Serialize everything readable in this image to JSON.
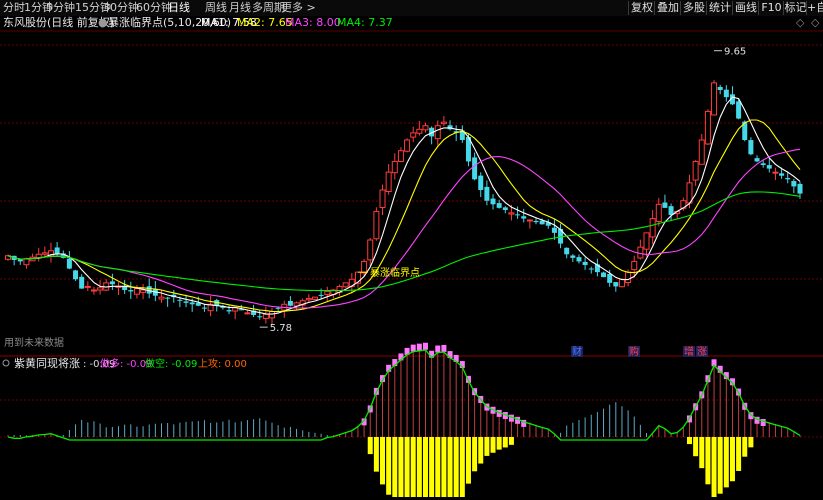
{
  "toolbar": {
    "period_tabs": [
      "分时",
      "1分钟",
      "5分钟",
      "15分钟",
      "30分钟",
      "60分钟",
      "日线",
      "周线",
      "月线",
      "多周期",
      "更多 >"
    ],
    "active_tab": "日线",
    "right_buttons": [
      "复权",
      "叠加",
      "多股",
      "统计",
      "画线",
      "F10",
      "标记",
      "+自"
    ]
  },
  "main_panel": {
    "stock_name": "东风股份(日线 前复权)",
    "indicator_name": "暴涨临界点(5,10,20,60)",
    "ma": [
      {
        "label": "MA1: 7.58",
        "color": "#ffffff"
      },
      {
        "label": "MA2: 7.65",
        "color": "#ffff00"
      },
      {
        "label": "MA3: 8.00",
        "color": "#ff44ff"
      },
      {
        "label": "MA4: 7.37",
        "color": "#00ee00"
      }
    ],
    "high_label": "9.65",
    "low_label": "5.78",
    "signal_label": "暴涨临界点",
    "footnote": "用到未来数据",
    "markers": [
      {
        "text": "财",
        "color": "#3f7fff"
      },
      {
        "text": "购",
        "color": "#ff4040"
      },
      {
        "text": "增",
        "color": "#ff4040"
      },
      {
        "text": "涨",
        "color": "#ff4040"
      }
    ]
  },
  "sub_panel": {
    "title": "紫黄同现将涨",
    "items": [
      {
        "label": ": -0.09",
        "color": "#dddddd"
      },
      {
        "label": "做多: -0.09",
        "color": "#ff44ff"
      },
      {
        "label": "做空: -0.09",
        "color": "#00ee00"
      },
      {
        "label": "上攻: 0.00",
        "color": "#ff6600"
      }
    ]
  },
  "colors": {
    "up": "#ff3b3b",
    "down": "#44d8e8",
    "ma1": "#ffffff",
    "ma2": "#ffff00",
    "ma3": "#ff44ff",
    "ma4": "#00ee00",
    "purple_bar": "#ff77ff",
    "yellow_bar": "#ffff00"
  },
  "chart_data": {
    "type": "candlestick",
    "title": "东风股份(日线 前复权)",
    "y_annotations": {
      "max": 9.65,
      "min": 5.78
    },
    "moving_averages": {
      "MA1": 7.58,
      "MA2": 7.65,
      "MA3": 8.0,
      "MA4": 7.37
    },
    "closes": [
      6.78,
      6.72,
      6.7,
      6.74,
      6.76,
      6.8,
      6.82,
      6.85,
      6.8,
      6.75,
      6.6,
      6.45,
      6.32,
      6.35,
      6.3,
      6.33,
      6.4,
      6.38,
      6.35,
      6.3,
      6.28,
      6.32,
      6.3,
      6.25,
      6.22,
      6.2,
      6.18,
      6.2,
      6.15,
      6.12,
      6.1,
      6.08,
      6.05,
      6.1,
      6.08,
      6.05,
      6.0,
      6.05,
      6.02,
      5.98,
      5.95,
      5.92,
      5.96,
      6.0,
      6.05,
      6.1,
      6.08,
      6.12,
      6.15,
      6.18,
      6.2,
      6.22,
      6.28,
      6.3,
      6.35,
      6.4,
      6.45,
      6.55,
      6.7,
      7.0,
      7.4,
      7.7,
      7.95,
      8.1,
      8.25,
      8.4,
      8.5,
      8.55,
      8.6,
      8.45,
      8.6,
      8.65,
      8.55,
      8.5,
      8.4,
      8.1,
      7.85,
      7.7,
      7.55,
      7.5,
      7.45,
      7.42,
      7.38,
      7.35,
      7.3,
      7.28,
      7.25,
      7.22,
      7.2,
      7.1,
      6.95,
      6.8,
      6.75,
      6.7,
      6.65,
      6.6,
      6.55,
      6.48,
      6.4,
      6.35,
      6.45,
      6.55,
      6.7,
      6.9,
      7.1,
      7.3,
      7.5,
      7.45,
      7.35,
      7.4,
      7.55,
      7.8,
      8.1,
      8.4,
      8.8,
      9.2,
      9.1,
      9.0,
      8.9,
      8.7,
      8.4,
      8.2,
      8.1,
      8.05,
      8.0,
      7.95,
      7.9,
      7.85,
      7.75,
      7.65
    ],
    "sub_indicator": {
      "title": "紫黄同现将涨",
      "value": -0.09,
      "做多": -0.09,
      "做空": -0.09,
      "上攻": 0.0
    }
  }
}
